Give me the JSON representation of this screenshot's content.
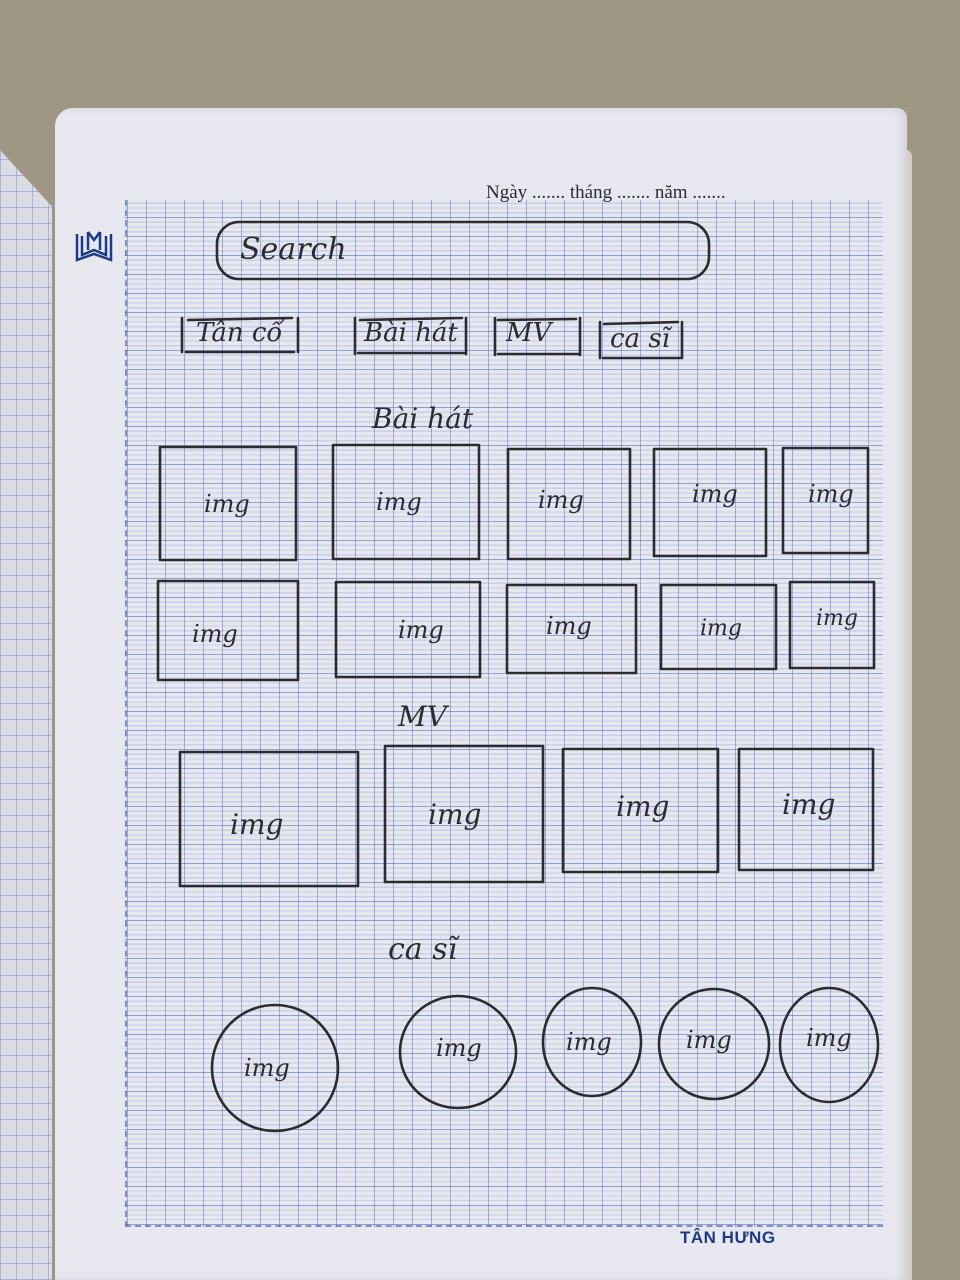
{
  "header": {
    "date_line": "Ngày ....... tháng ....... năm ......."
  },
  "footer": {
    "brand": "TÂN HƯNG"
  },
  "sketch": {
    "search": {
      "label": "Search"
    },
    "nav_buttons": [
      {
        "label": "Tân cổ"
      },
      {
        "label": "Bài hát"
      },
      {
        "label": "MV"
      },
      {
        "label": "ca sĩ"
      }
    ],
    "sections": [
      {
        "title": "Bài hát",
        "placeholder": "img",
        "count": 10
      },
      {
        "title": "MV",
        "placeholder": "img",
        "count": 4
      },
      {
        "title": "ca sĩ",
        "placeholder": "img",
        "count": 5
      }
    ]
  },
  "colors": {
    "paper": "#e7e8ef",
    "grid": "#4664b9",
    "ink": "#2b2b30",
    "brand": "#1c3a85",
    "table": "#9f9783"
  }
}
